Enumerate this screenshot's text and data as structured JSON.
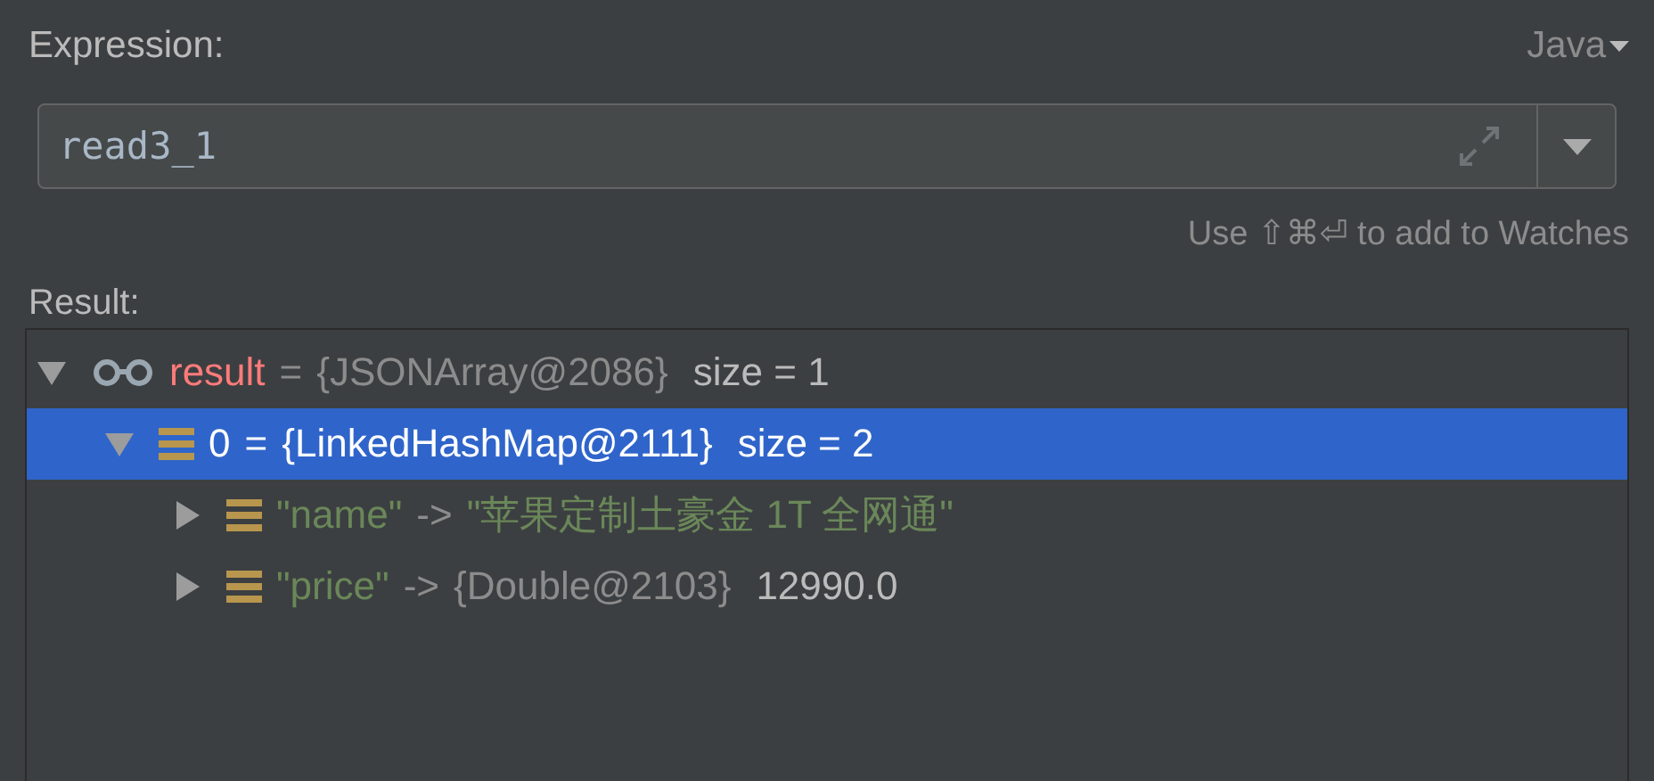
{
  "expression": {
    "label": "Expression:",
    "language": "Java",
    "value": "read3_1",
    "hint": "Use ⇧⌘⏎ to add to Watches"
  },
  "result": {
    "label": "Result:",
    "tree": [
      {
        "kind": "watch",
        "expanded": true,
        "selected": false,
        "key": "result",
        "separator": "=",
        "type": "{JSONArray@2086}",
        "value": "size = 1",
        "children": [
          {
            "kind": "element",
            "expanded": true,
            "selected": true,
            "key": "0",
            "separator": "=",
            "type": "{LinkedHashMap@2111}",
            "value": "size = 2",
            "children": [
              {
                "kind": "entry",
                "expanded": false,
                "selected": false,
                "key": "\"name\"",
                "separator": "->",
                "string_value": "\"苹果定制土豪金 1T  全网通\""
              },
              {
                "kind": "entry",
                "expanded": false,
                "selected": false,
                "key": "\"price\"",
                "separator": "->",
                "type": "{Double@2103}",
                "value": "12990.0"
              }
            ]
          }
        ]
      }
    ]
  }
}
